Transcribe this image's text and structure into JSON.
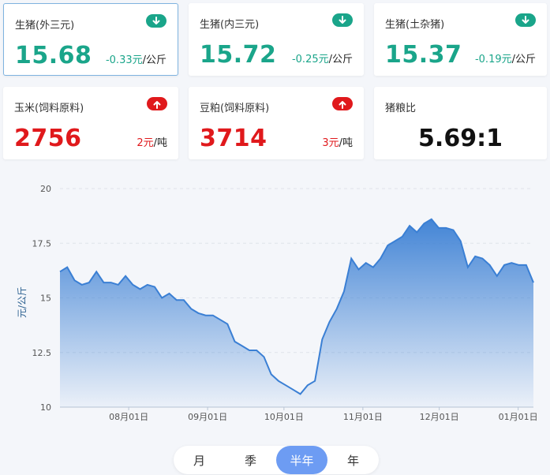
{
  "colors": {
    "down": "#1aa58a",
    "up": "#e0191c",
    "line": "#3a7fd4"
  },
  "cards": [
    {
      "title": "生猪(外三元)",
      "value": "15.68",
      "change": "-0.33元",
      "unit": "/公斤",
      "dir": "down",
      "icon": "arrow-down-icon"
    },
    {
      "title": "生猪(内三元)",
      "value": "15.72",
      "change": "-0.25元",
      "unit": "/公斤",
      "dir": "down",
      "icon": "arrow-down-icon"
    },
    {
      "title": "生猪(土杂猪)",
      "value": "15.37",
      "change": "-0.19元",
      "unit": "/公斤",
      "dir": "down",
      "icon": "arrow-down-icon"
    },
    {
      "title": "玉米(饲料原料)",
      "value": "2756",
      "change": "2元",
      "unit": "/吨",
      "dir": "up",
      "icon": "arrow-up-icon"
    },
    {
      "title": "豆粕(饲料原料)",
      "value": "3714",
      "change": "3元",
      "unit": "/吨",
      "dir": "up",
      "icon": "arrow-up-icon"
    },
    {
      "title": "猪粮比",
      "value": "5.69:1"
    }
  ],
  "chart_data": {
    "type": "area",
    "ylabel": "元/公斤",
    "ylim": [
      10,
      20
    ],
    "yticks": [
      "10",
      "12.5",
      "15",
      "17.5",
      "20"
    ],
    "grid": "horizontal-dashed",
    "xticks": [
      "08月01日",
      "09月01日",
      "10月01日",
      "11月01日",
      "12月01日",
      "01月01日"
    ],
    "x": [
      "07-05",
      "07-08",
      "07-11",
      "07-14",
      "07-17",
      "07-20",
      "07-23",
      "07-26",
      "07-29",
      "08-01",
      "08-04",
      "08-07",
      "08-10",
      "08-13",
      "08-16",
      "08-19",
      "08-22",
      "08-25",
      "08-28",
      "08-31",
      "09-03",
      "09-06",
      "09-09",
      "09-12",
      "09-15",
      "09-18",
      "09-21",
      "09-24",
      "09-27",
      "09-30",
      "10-03",
      "10-06",
      "10-09",
      "10-12",
      "10-15",
      "10-18",
      "10-21",
      "10-24",
      "10-27",
      "10-30",
      "11-02",
      "11-05",
      "11-08",
      "11-11",
      "11-14",
      "11-17",
      "11-20",
      "11-23",
      "11-26",
      "11-29",
      "12-02",
      "12-05",
      "12-08",
      "12-11",
      "12-14",
      "12-17",
      "12-20",
      "12-23",
      "12-26",
      "12-29",
      "01-01",
      "01-04"
    ],
    "values": [
      16.2,
      16.4,
      15.8,
      15.6,
      15.7,
      16.2,
      15.7,
      15.7,
      15.6,
      16.0,
      15.6,
      15.4,
      15.6,
      15.5,
      15.0,
      15.2,
      14.9,
      14.9,
      14.5,
      14.3,
      14.2,
      14.2,
      14.0,
      13.8,
      13.0,
      12.8,
      12.6,
      12.6,
      12.3,
      11.5,
      11.2,
      11.0,
      10.8,
      10.6,
      11.0,
      11.2,
      13.1,
      13.9,
      14.5,
      15.3,
      16.8,
      16.3,
      16.6,
      16.4,
      16.8,
      17.4,
      17.6,
      17.8,
      18.3,
      18.0,
      18.4,
      18.6,
      18.2,
      18.2,
      18.1,
      17.6,
      16.4,
      16.9,
      16.8,
      16.5,
      16.0,
      16.5,
      16.6,
      16.5,
      16.5,
      15.7
    ],
    "x_range_days": [
      0,
      186
    ],
    "xtick_days": [
      27,
      58,
      88,
      119,
      149,
      180
    ]
  },
  "periods": {
    "items": [
      "月",
      "季",
      "半年",
      "年"
    ],
    "active": 2
  }
}
